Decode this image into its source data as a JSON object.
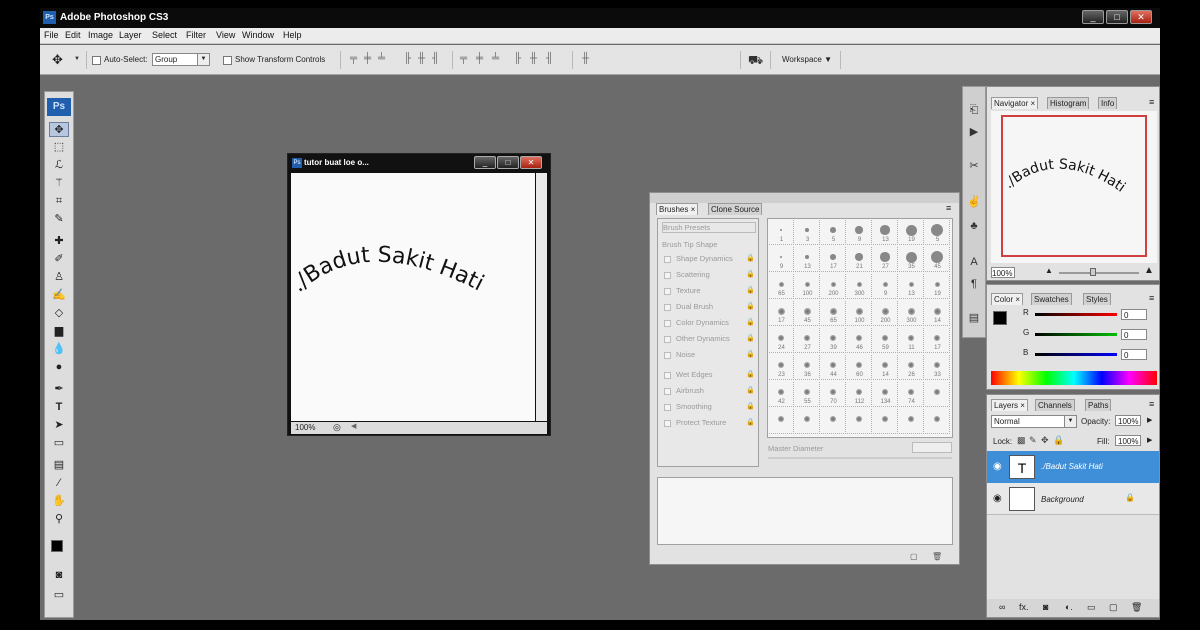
{
  "app": {
    "title": "Adobe Photoshop CS3",
    "logo": "Ps"
  },
  "window_controls": {
    "minimize": "_",
    "maximize": "□",
    "close": "✕"
  },
  "menu": [
    "File",
    "Edit",
    "Image",
    "Layer",
    "Select",
    "Filter",
    "View",
    "Window",
    "Help"
  ],
  "options": {
    "auto_select_label": "Auto-Select:",
    "auto_select_value": "Group",
    "show_transform_label": "Show Transform Controls",
    "workspace_label": "Workspace ▼"
  },
  "toolbox": {
    "logo": "Ps"
  },
  "document": {
    "title": "tutor buat loe o...",
    "zoom": "100%",
    "canvas_text": "./Badut Sakit Hati"
  },
  "brushes_panel": {
    "tabs": [
      "Brushes ×",
      "Clone Source"
    ],
    "items": [
      "Brush Presets",
      "Brush Tip Shape",
      "Shape Dynamics",
      "Scattering",
      "Texture",
      "Dual Brush",
      "Color Dynamics",
      "Other Dynamics",
      "Noise",
      "Wet Edges",
      "Airbrush",
      "Smoothing",
      "Protect Texture"
    ],
    "master_diameter_label": "Master Diameter",
    "sizes": [
      "1",
      "3",
      "5",
      "9",
      "13",
      "19",
      "5",
      "9",
      "13",
      "17",
      "21",
      "27",
      "35",
      "45",
      "65",
      "100",
      "200",
      "300",
      "9",
      "13",
      "19",
      "17",
      "45",
      "65",
      "100",
      "200",
      "300",
      "14",
      "24",
      "27",
      "39",
      "46",
      "59",
      "11",
      "17",
      "23",
      "36",
      "44",
      "60",
      "14",
      "26",
      "33",
      "42",
      "55",
      "70",
      "112",
      "134",
      "74"
    ]
  },
  "navigator_panel": {
    "tabs": [
      "Navigator ×",
      "Histogram",
      "Info"
    ],
    "zoom": "100%",
    "preview_text": "./Badut Sakit Hati"
  },
  "color_panel": {
    "tabs": [
      "Color ×",
      "Swatches",
      "Styles"
    ],
    "channels": [
      {
        "label": "R",
        "value": "0"
      },
      {
        "label": "G",
        "value": "0"
      },
      {
        "label": "B",
        "value": "0"
      }
    ],
    "colors": {
      "r": "#ff0000",
      "g": "#00c000",
      "b": "#0000ff"
    }
  },
  "layers_panel": {
    "tabs": [
      "Layers ×",
      "Channels",
      "Paths"
    ],
    "blend_mode": "Normal",
    "opacity_label": "Opacity:",
    "opacity": "100%",
    "lock_label": "Lock:",
    "fill_label": "Fill:",
    "fill": "100%",
    "layers": [
      {
        "name": "./Badut Sakit Hati",
        "thumb": "T",
        "selected": true
      },
      {
        "name": "Background",
        "thumb": "",
        "selected": false
      }
    ],
    "footer_icons": [
      "∞",
      "fx.",
      "◙",
      "◐.",
      "▭",
      "▢",
      "🗑"
    ]
  },
  "accent": {
    "selection": "#3f8fd8",
    "nav_frame": "#d04040"
  }
}
